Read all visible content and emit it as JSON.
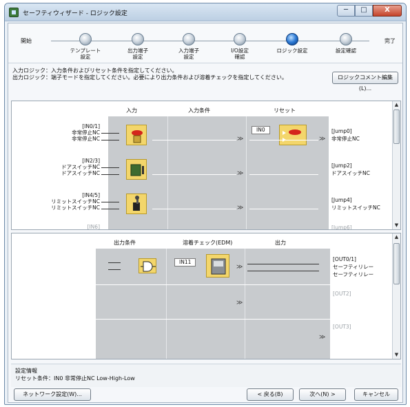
{
  "window": {
    "title": "セーフティウィザード - ロジック設定",
    "minimize": "─",
    "maximize": "□",
    "close": "X"
  },
  "wizard": {
    "start": "開始",
    "end": "完了",
    "steps": [
      {
        "label": "テンプレート\n設定"
      },
      {
        "label": "出力端子\n設定"
      },
      {
        "label": "入力端子\n設定"
      },
      {
        "label": "I/O設定\n確認"
      },
      {
        "label": "ロジック設定"
      },
      {
        "label": "設定確認"
      }
    ],
    "active_step_index": 4
  },
  "instructions": {
    "line1": "入力ロジック：入力条件およびリセット条件を指定してください。",
    "line2": "出力ロジック：端子モードを指定してください。必要により出力条件および溶着チェックを指定してください。",
    "comment_button": "ロジックコメント編集(L)..."
  },
  "input_logic": {
    "headers": {
      "input": "入力",
      "input_condition": "入力条件",
      "reset": "リセット"
    },
    "rows": [
      {
        "label1": "[IN0/1]",
        "label2": "非常停止NC",
        "label3": "非常停止NC",
        "output1": "[Jump0]",
        "output2": "非常停止NC",
        "icon": "emergency-stop-icon",
        "reset_tag": "IN0"
      },
      {
        "label1": "[IN2/3]",
        "label2": "ドアスイッチNC",
        "label3": "ドアスイッチNC",
        "output1": "[Jump2]",
        "output2": "ドアスイッチNC",
        "icon": "door-switch-icon"
      },
      {
        "label1": "[IN4/5]",
        "label2": "リミットスイッチNC",
        "label3": "リミットスイッチNC",
        "output1": "[Jump4]",
        "output2": "リミットスイッチNC",
        "icon": "limit-switch-icon"
      },
      {
        "label1": "[IN6]",
        "output1": "[Jump6]"
      }
    ]
  },
  "output_logic": {
    "headers": {
      "output_condition": "出力条件",
      "edm": "溶着チェック(EDM)",
      "output": "出力"
    },
    "rows": [
      {
        "output1": "[OUT0/1]",
        "output2": "セーフティリレー",
        "output3": "セーフティリレー",
        "edm_tag": "IN11"
      },
      {
        "output1": "[OUT2]"
      },
      {
        "output1": "[OUT3]"
      }
    ]
  },
  "info": {
    "title": "設定情報",
    "text": "リセット条件：IN0 非常停止NC Low-High-Low"
  },
  "footer": {
    "network_button": "ネットワーク設定(W)...",
    "back_button": "< 戻る(B)",
    "next_button": "次へ(N) >",
    "cancel_button": "キャンセル"
  }
}
